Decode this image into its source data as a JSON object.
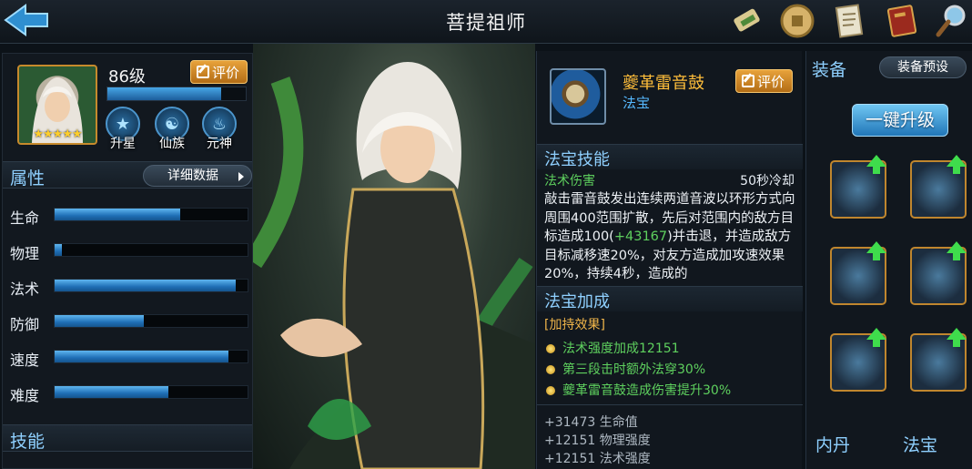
{
  "header": {
    "title": "菩提祖师"
  },
  "hero": {
    "level": "86级",
    "eval_label": "评价",
    "exp_fraction": 0.82,
    "star_count": 5,
    "badges": [
      {
        "label": "升星",
        "icon": "star-icon"
      },
      {
        "label": "仙族",
        "icon": "yin-yang-icon"
      },
      {
        "label": "元神",
        "icon": "flame-icon"
      }
    ]
  },
  "attributes": {
    "title": "属性",
    "detail_label": "详细数据",
    "stats": [
      {
        "name": "生命",
        "fraction": 0.65
      },
      {
        "name": "物理",
        "fraction": 0.04
      },
      {
        "name": "法术",
        "fraction": 0.94
      },
      {
        "name": "防御",
        "fraction": 0.46
      },
      {
        "name": "速度",
        "fraction": 0.9
      },
      {
        "name": "难度",
        "fraction": 0.59
      }
    ]
  },
  "skills": {
    "title": "技能"
  },
  "item": {
    "name": "夔革雷音鼓",
    "type": "法宝",
    "eval_label": "评价",
    "skill_section": "法宝技能",
    "damage_type": "法术伤害",
    "cooldown": "50秒冷却",
    "desc_part1": "敲击雷音鼓发出连续两道音波以环形方式向周围400范围扩散，先后对范围内的敌方目标造成100(",
    "desc_bonus": "+43167",
    "desc_part2": ")并击退，并造成敌方目标减移速20%，对友方造成加攻速效果20%，持续4秒，造成的",
    "bonus_section": "法宝加成",
    "bonus_head": "[加持效果]",
    "bonuses": [
      "法术强度加成12151",
      "第三段击时额外法穿30%",
      "夔革雷音鼓造成伤害提升30%"
    ],
    "attr_lines": [
      "+31473 生命值",
      "+12151 物理强度",
      "+12151 法术强度"
    ]
  },
  "equipment": {
    "title": "装备",
    "preset_label": "装备预设",
    "upgrade_label": "一键升级",
    "tabs": [
      "内丹",
      "法宝"
    ]
  },
  "colors": {
    "accent": "#8fd0ff",
    "gold": "#ffbe3a",
    "green": "#5ed05e",
    "bar": "#1f6fb6"
  }
}
